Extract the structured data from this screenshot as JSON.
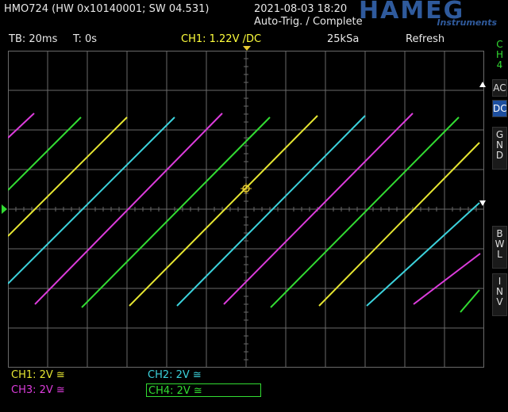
{
  "header": {
    "device_id": "HMO724 (HW 0x10140001; SW 04.531)",
    "datetime": "2021-08-03 18:20",
    "trigger_status": "Auto-Trig. / Complete",
    "logo_brand": "HAMEG",
    "logo_sub": "Instruments"
  },
  "status": {
    "timebase": "TB: 20ms",
    "trigger_time": "T: 0s",
    "ch1_trigger": "CH1: 1.22V ∕DC",
    "sample_rate": "25kSa",
    "acq_mode": "Refresh"
  },
  "side_menu": {
    "channel": "CH4",
    "ac": "AC",
    "dc": "DC",
    "gnd": "GND",
    "bwl": "BWL",
    "inv": "INV"
  },
  "channels": [
    {
      "label": "CH1: 2V ≅",
      "color": "#e6e632"
    },
    {
      "label": "CH2: 2V ≅",
      "color": "#3cd2dc"
    },
    {
      "label": "CH3: 2V ≅",
      "color": "#dc3cdc"
    },
    {
      "label": "CH4: 2V ≅",
      "color": "#32dc32"
    }
  ],
  "colors": {
    "grid": "#6a6a6a",
    "trigger_marker": "#e6c832",
    "accent": "#1d4fa0"
  }
}
